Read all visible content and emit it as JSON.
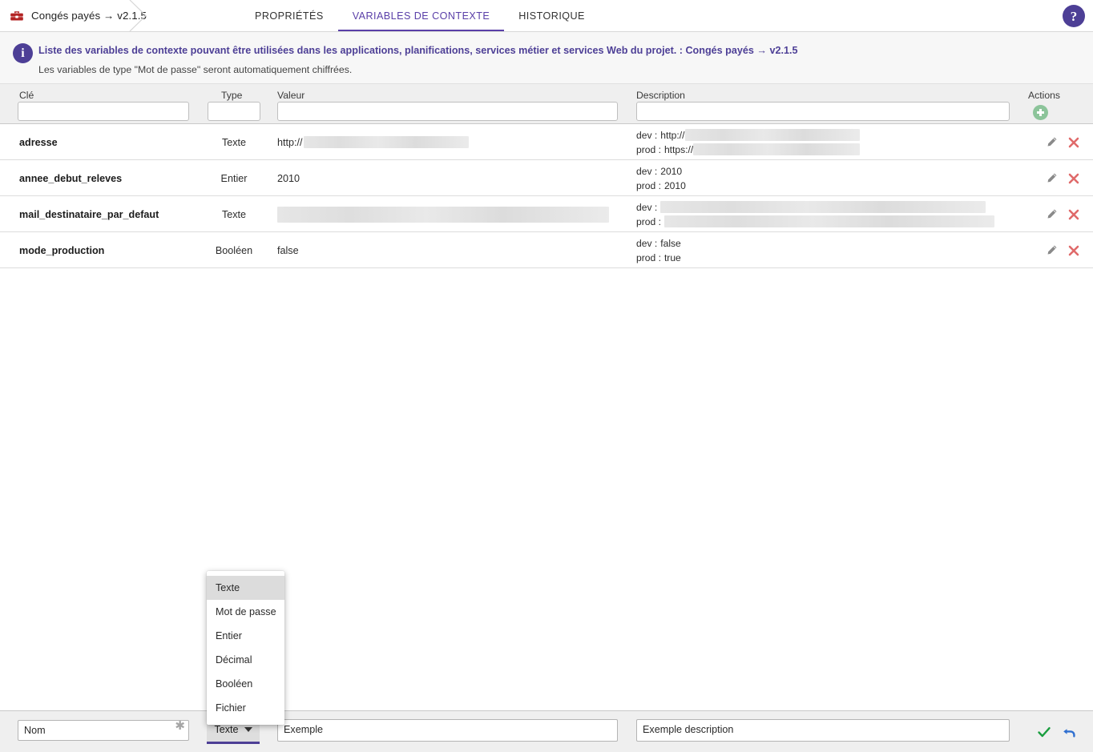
{
  "topbar": {
    "breadcrumb": {
      "icon": "toolbox-icon",
      "label": "Congés payés → v2.1.5"
    },
    "tabs": [
      {
        "label": "PROPRIÉTÉS",
        "active": false
      },
      {
        "label": "VARIABLES DE CONTEXTE",
        "active": true
      },
      {
        "label": "HISTORIQUE",
        "active": false
      }
    ],
    "help_icon": "question-mark-icon",
    "help_label": "?"
  },
  "banner": {
    "icon": "info-icon",
    "icon_label": "i",
    "line1": "Liste des variables de contexte pouvant être utilisées dans les applications, planifications, services métier et services Web du projet. : Congés payés → v2.1.5",
    "line2": "Les variables de type \"Mot de passe\" seront automatiquement chiffrées."
  },
  "table": {
    "columns": [
      {
        "label": "Clé",
        "key": "cle"
      },
      {
        "label": "Type",
        "key": "type"
      },
      {
        "label": "Valeur",
        "key": "valeur"
      },
      {
        "label": "Description",
        "key": "description"
      },
      {
        "label": "Actions",
        "key": "actions"
      }
    ],
    "filters": {
      "cle": "",
      "type": "",
      "valeur": "",
      "description": ""
    },
    "add_icon": "plus-circle-icon",
    "rows": [
      {
        "cle": "adresse",
        "type": "Texte",
        "valeur": "http://",
        "valeur_redacted": true,
        "desc_dev_label": "dev :",
        "desc_dev_value": "http://",
        "desc_dev_redacted": true,
        "desc_prod_label": "prod :",
        "desc_prod_value": "https://",
        "desc_prod_redacted": true,
        "edit_icon": "pencil-icon",
        "delete_icon": "close-x-icon"
      },
      {
        "cle": "annee_debut_releves",
        "type": "Entier",
        "valeur": "2010",
        "valeur_redacted": false,
        "desc_dev_label": "dev :",
        "desc_dev_value": "2010",
        "desc_dev_redacted": false,
        "desc_prod_label": "prod :",
        "desc_prod_value": "2010",
        "desc_prod_redacted": false,
        "edit_icon": "pencil-icon",
        "delete_icon": "close-x-icon"
      },
      {
        "cle": "mail_destinataire_par_defaut",
        "type": "Texte",
        "valeur": "",
        "valeur_redacted": true,
        "desc_dev_label": "dev :",
        "desc_dev_value": "",
        "desc_dev_redacted": true,
        "desc_prod_label": "prod :",
        "desc_prod_value": "",
        "desc_prod_redacted": true,
        "edit_icon": "pencil-icon",
        "delete_icon": "close-x-icon"
      },
      {
        "cle": "mode_production",
        "type": "Booléen",
        "valeur": "false",
        "valeur_redacted": false,
        "desc_dev_label": "dev :",
        "desc_dev_value": "false",
        "desc_dev_redacted": false,
        "desc_prod_label": "prod :",
        "desc_prod_value": "true",
        "desc_prod_redacted": false,
        "edit_icon": "pencil-icon",
        "delete_icon": "close-x-icon"
      }
    ]
  },
  "type_dropdown": {
    "open": true,
    "selected": "Texte",
    "options": [
      {
        "label": "Texte",
        "selected": true
      },
      {
        "label": "Mot de passe",
        "selected": false
      },
      {
        "label": "Entier",
        "selected": false
      },
      {
        "label": "Décimal",
        "selected": false
      },
      {
        "label": "Booléen",
        "selected": false
      },
      {
        "label": "Fichier",
        "selected": false
      }
    ]
  },
  "editbar": {
    "nom_value": "Nom",
    "nom_placeholder": "Nom",
    "required_marker": "✱",
    "type_value": "Texte",
    "caret_icon": "chevron-down-icon",
    "valeur_value": "Exemple",
    "valeur_placeholder": "Exemple",
    "description_value": "Exemple description",
    "description_placeholder": "Exemple description",
    "confirm_icon": "check-icon",
    "cancel_icon": "undo-arrow-icon"
  },
  "colors": {
    "accent_purple": "#4d3f96",
    "tab_active": "#5a3fa8",
    "toolbox_red": "#b32424",
    "add_green": "#8cc49a",
    "delete_red": "#e06a6a",
    "check_green": "#1a9e3f",
    "undo_blue": "#2f6fd0",
    "header_bg": "#efefef",
    "banner_bg": "#f7f7f7"
  }
}
